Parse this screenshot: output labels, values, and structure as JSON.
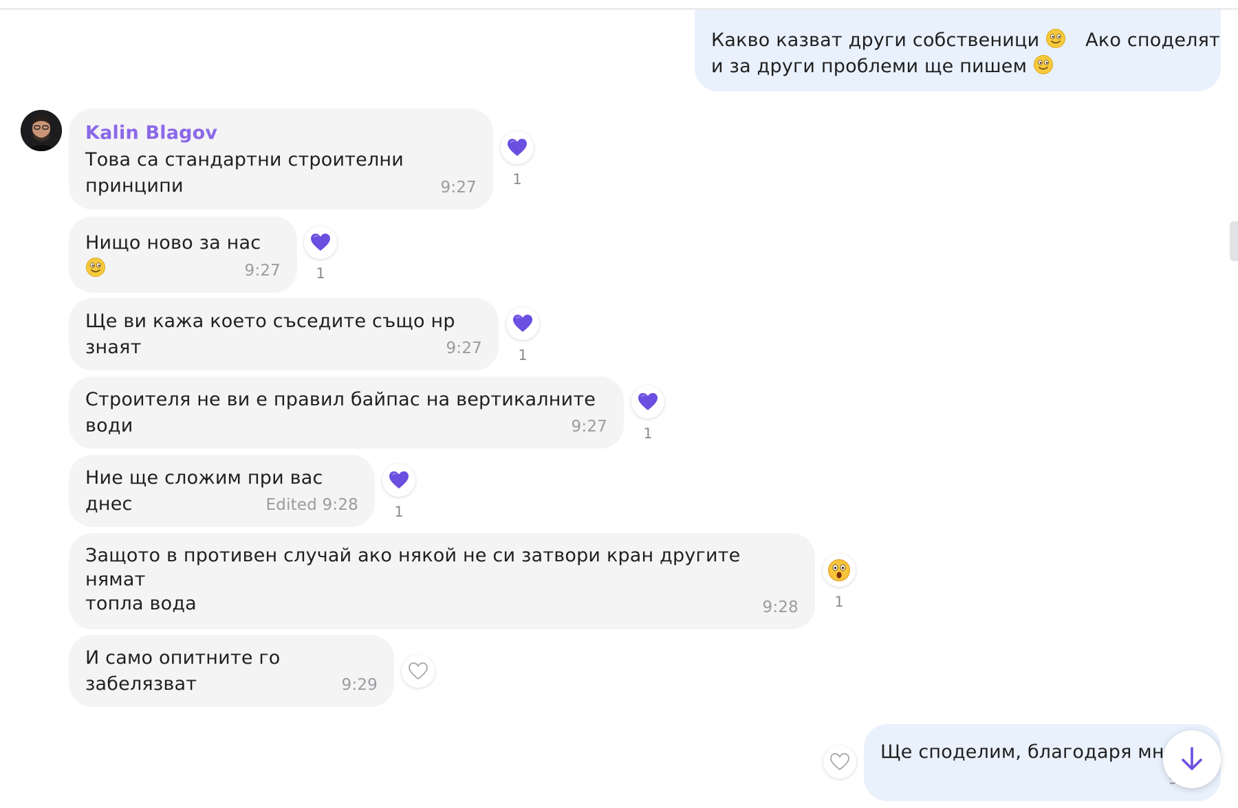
{
  "colors": {
    "accent": "#8b68e8",
    "heart": "#6a4fe0",
    "incoming_bg": "#f4f4f5",
    "outgoing_bg": "#e9f1fd"
  },
  "messages": [
    {
      "direction": "outgoing",
      "text_line1": "Какво казват други собственици",
      "text_line1b": "Ако споделят",
      "text_line2": "и за други проблеми ще пишем"
    },
    {
      "direction": "incoming",
      "sender": "Kalin Blagov",
      "text": "Това са стандартни строителни принципи",
      "time": "9:27",
      "reaction": {
        "icon": "heart-icon",
        "count": "1"
      }
    },
    {
      "direction": "incoming",
      "text": "Нищо ново за нас",
      "time": "9:27",
      "reaction": {
        "icon": "heart-icon",
        "count": "1"
      }
    },
    {
      "direction": "incoming",
      "text": "Ще ви кажа което съседите също нр знаят",
      "time": "9:27",
      "reaction": {
        "icon": "heart-icon",
        "count": "1"
      }
    },
    {
      "direction": "incoming",
      "text": "Строителя не ви е правил байпас на вертикалните води",
      "time": "9:27",
      "reaction": {
        "icon": "heart-icon",
        "count": "1"
      }
    },
    {
      "direction": "incoming",
      "text": "Ние ще сложим при вас днес",
      "time": "Edited 9:28",
      "reaction": {
        "icon": "heart-icon",
        "count": "1"
      }
    },
    {
      "direction": "incoming",
      "text": "Защото в противен случай ако някой не си затвори кран другите нямат\nтопла вода",
      "time": "9:28",
      "reaction": {
        "icon": "astonished-emoji-icon",
        "count": "1"
      }
    },
    {
      "direction": "incoming",
      "text": "И само опитните го забелязват",
      "time": "9:29",
      "reaction": {
        "icon": "heart-outline-icon",
        "count": ""
      }
    },
    {
      "direction": "outgoing",
      "text": "Ще споделим, благодаря мног",
      "time": "9:29",
      "reaction": {
        "icon": "heart-outline-icon",
        "count": ""
      }
    }
  ],
  "scroll_button": {
    "icon": "arrow-down-icon"
  }
}
